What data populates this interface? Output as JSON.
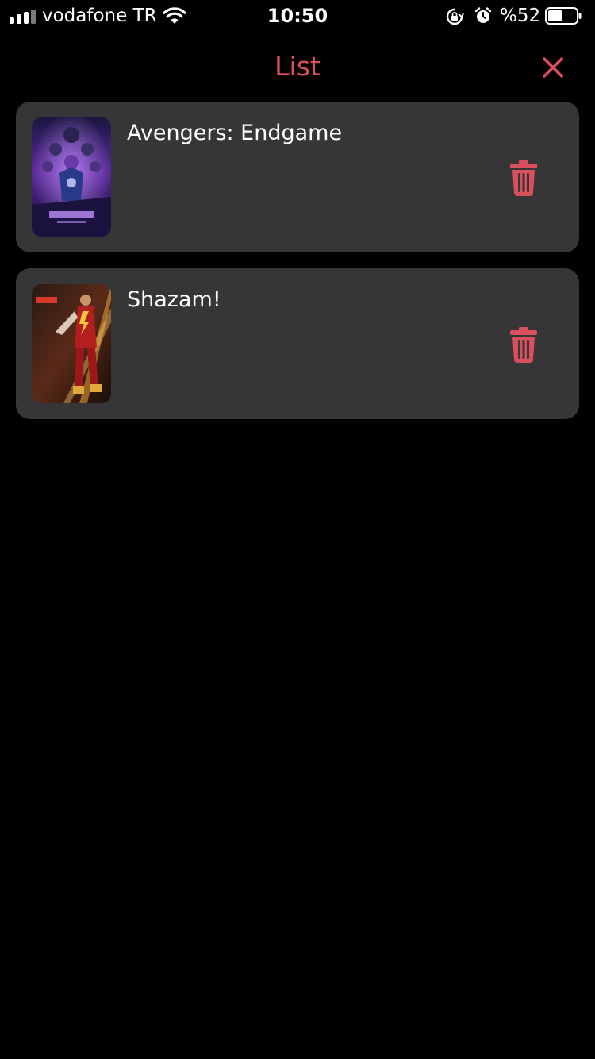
{
  "status_bar": {
    "carrier": "vodafone TR",
    "time": "10:50",
    "battery_percent": "%52",
    "battery_level": 0.52,
    "signal_bars_active": 3,
    "signal_bars_total": 4
  },
  "nav": {
    "title": "List",
    "close_icon": "close-icon"
  },
  "colors": {
    "accent": "#d94f5c",
    "background": "#000000",
    "card": "#363638",
    "text": "#ffffff"
  },
  "items": [
    {
      "title": "Avengers: Endgame",
      "poster_icon": "avengers-endgame-poster",
      "delete_icon": "trash-icon"
    },
    {
      "title": "Shazam!",
      "poster_icon": "shazam-poster",
      "delete_icon": "trash-icon"
    }
  ]
}
